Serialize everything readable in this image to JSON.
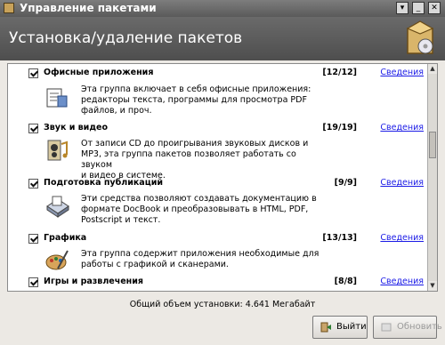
{
  "window": {
    "title": "Управление пакетами"
  },
  "banner": {
    "heading": "Установка/удаление пакетов"
  },
  "groups": [
    {
      "name": "Офисные приложения",
      "count": "[12/12]",
      "link": "Сведения",
      "checked": true,
      "desc": [
        "Эта группа включает в себя офисные приложения:",
        "редакторы текста, программы для просмотра PDF",
        "файлов, и проч."
      ],
      "icon": "office-icon"
    },
    {
      "name": "Звук и видео",
      "count": "[19/19]",
      "link": "Сведения",
      "checked": true,
      "desc": [
        "От записи CD до проигрывания звуковых дисков и",
        "MP3, эта группа пакетов позволяет работать со звуком",
        "и видео в системе."
      ],
      "icon": "sound-video-icon"
    },
    {
      "name": "Подготовка публикаций",
      "count": "[9/9]",
      "link": "Сведения",
      "checked": true,
      "desc": [
        "Эти средства позволяют создавать документацию в",
        "формате DocBook и преобразовывать в HTML, PDF,",
        "Postscript и текст."
      ],
      "icon": "publishing-icon"
    },
    {
      "name": "Графика",
      "count": "[13/13]",
      "link": "Сведения",
      "checked": true,
      "desc": [
        "Эта группа содержит приложения необходимые для",
        "работы с графикой и сканерами."
      ],
      "icon": "graphics-icon"
    },
    {
      "name": "Игры и развлечения",
      "count": "[8/8]",
      "link": "Сведения",
      "checked": true,
      "desc": [],
      "icon": "games-icon"
    }
  ],
  "footer": {
    "total": "Общий объем установки: 4.641 Мегабайт"
  },
  "buttons": {
    "quit": "Выйти",
    "update": "Обновить"
  }
}
